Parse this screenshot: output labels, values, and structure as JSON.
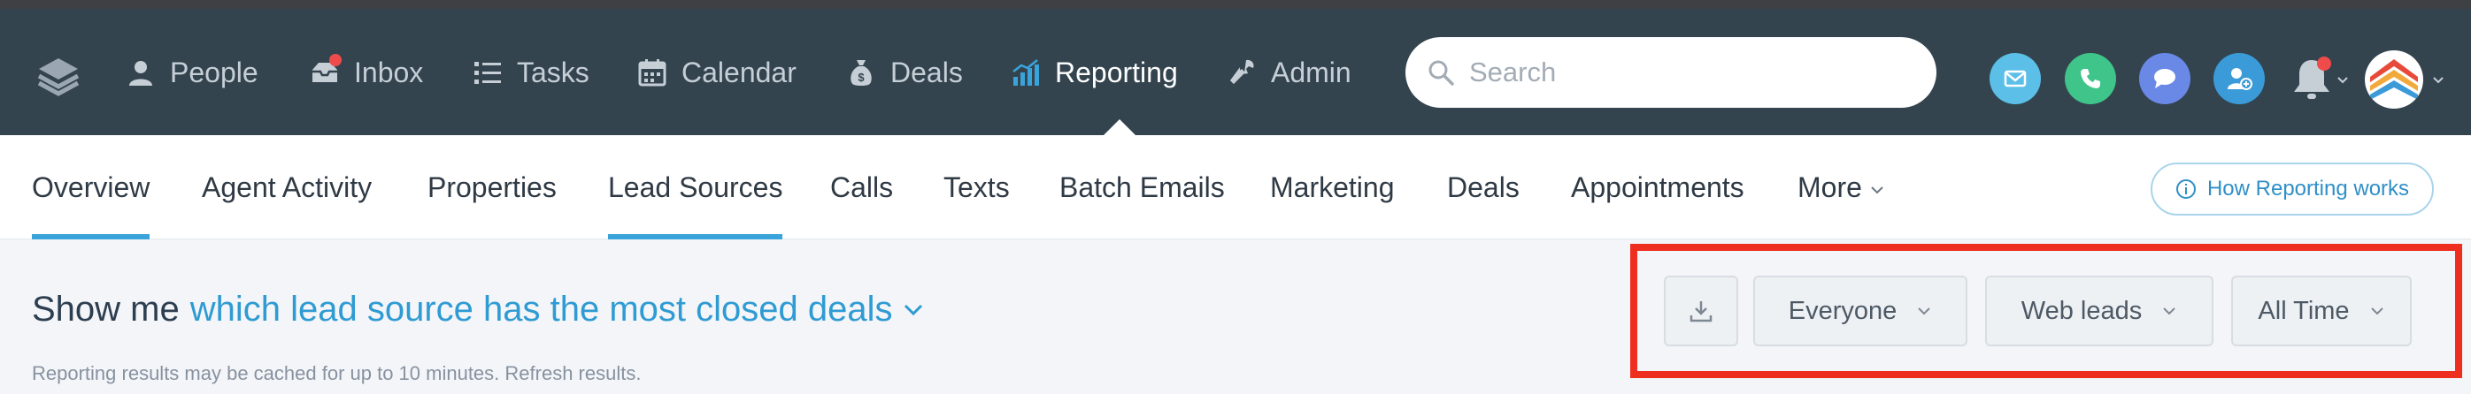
{
  "nav": {
    "items": [
      {
        "label": "People",
        "icon": "person-icon"
      },
      {
        "label": "Inbox",
        "icon": "inbox-icon"
      },
      {
        "label": "Tasks",
        "icon": "list-icon"
      },
      {
        "label": "Calendar",
        "icon": "calendar-icon"
      },
      {
        "label": "Deals",
        "icon": "money-bag-icon"
      },
      {
        "label": "Reporting",
        "icon": "bar-chart-icon",
        "active": true
      },
      {
        "label": "Admin",
        "icon": "wrench-icon"
      }
    ],
    "search_placeholder": "Search",
    "action_buttons": [
      {
        "name": "email",
        "color": "#5bbfe8"
      },
      {
        "name": "phone",
        "color": "#3fc48a"
      },
      {
        "name": "chat",
        "color": "#6a88e6"
      },
      {
        "name": "add-person",
        "color": "#3a9bd8"
      }
    ]
  },
  "subnav": {
    "tabs": [
      {
        "label": "Overview",
        "active": true
      },
      {
        "label": "Agent Activity"
      },
      {
        "label": "Properties"
      },
      {
        "label": "Lead Sources",
        "active": true
      },
      {
        "label": "Calls"
      },
      {
        "label": "Texts"
      },
      {
        "label": "Batch Emails"
      },
      {
        "label": "Marketing"
      },
      {
        "label": "Deals"
      },
      {
        "label": "Appointments"
      },
      {
        "label": "More"
      }
    ],
    "help_label": "How Reporting works"
  },
  "report": {
    "prefix": "Show me",
    "question": "which lead source has the most closed deals",
    "cache_note": "Reporting results may be cached for up to 10 minutes.",
    "refresh_label": "Refresh results."
  },
  "filters": {
    "agent": "Everyone",
    "source": "Web leads",
    "period": "All Time"
  },
  "colors": {
    "navbar": "#33444f",
    "accent": "#3aa3d9",
    "highlight": "#ee2e1f"
  }
}
